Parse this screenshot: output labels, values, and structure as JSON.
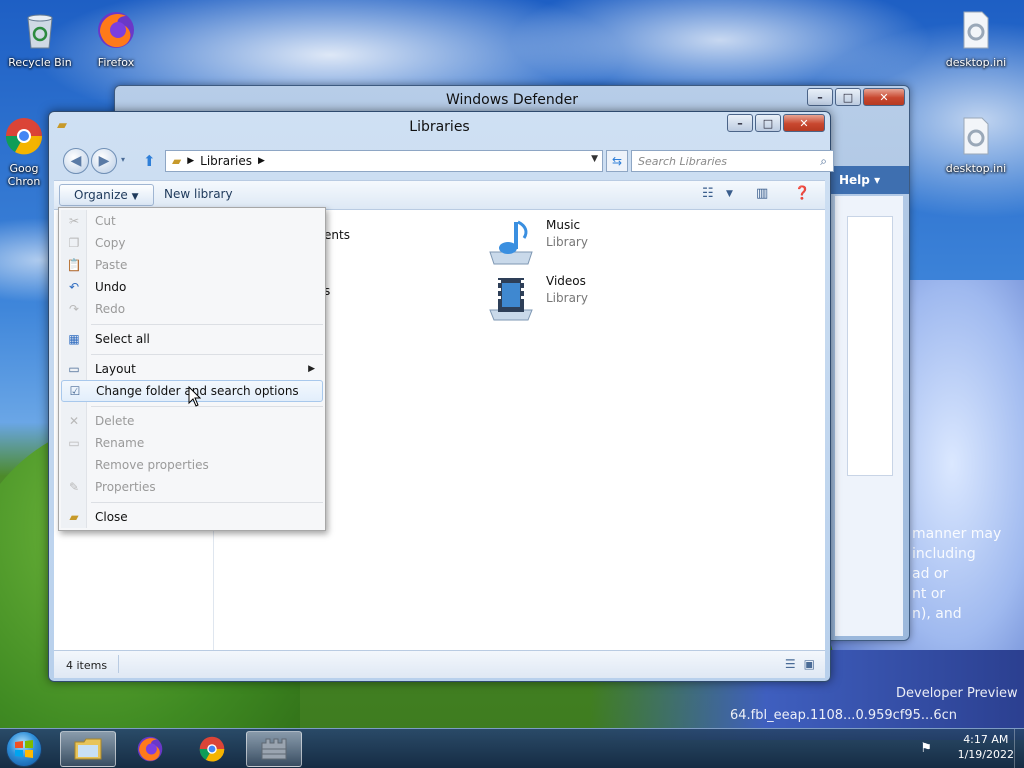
{
  "desktop": {
    "icons": [
      {
        "label": "Recycle Bin",
        "icon": "recycle-bin-icon"
      },
      {
        "label": "Firefox",
        "icon": "firefox-icon"
      },
      {
        "label": "Goog Chron",
        "icon": "chrome-icon"
      },
      {
        "label": "desktop.ini",
        "icon": "settings-file-icon"
      },
      {
        "label": "desktop.ini",
        "icon": "settings-file-icon"
      }
    ],
    "watermark_lines": [
      "manner may",
      "including",
      "ad or",
      "nt or",
      "n), and",
      "Developer Preview",
      "64.fbl_eeap.1108...0.959cf95...6cn"
    ]
  },
  "defender_window": {
    "title": "Windows Defender",
    "help_label": "Help"
  },
  "explorer": {
    "title": "Libraries",
    "address": {
      "crumb": "Libraries"
    },
    "search": {
      "placeholder": "Search Libraries"
    },
    "command_bar": {
      "organize_label": "Organize",
      "new_library_label": "New library"
    },
    "libraries": [
      {
        "name": "Music",
        "type": "Library",
        "icon": "music-library-icon"
      },
      {
        "name": "Videos",
        "type": "Library",
        "icon": "videos-library-icon"
      }
    ],
    "partial_text": {
      "documents": "ents",
      "pictures": "s"
    },
    "status": {
      "item_count": "4 items"
    }
  },
  "organize_menu": {
    "items": [
      {
        "label": "Cut",
        "enabled": false,
        "icon": "cut-icon"
      },
      {
        "label": "Copy",
        "enabled": false,
        "icon": "copy-icon"
      },
      {
        "label": "Paste",
        "enabled": false,
        "icon": "paste-icon"
      },
      {
        "label": "Undo",
        "enabled": true,
        "icon": "undo-icon"
      },
      {
        "label": "Redo",
        "enabled": false,
        "icon": "redo-icon"
      },
      {
        "label": "Select all",
        "enabled": true,
        "icon": "select-all-icon"
      },
      {
        "label": "Layout",
        "enabled": true,
        "icon": "layout-icon",
        "submenu": true
      },
      {
        "label": "Change folder and search options",
        "enabled": true,
        "icon": "folder-options-icon",
        "highlighted": true
      },
      {
        "label": "Delete",
        "enabled": false,
        "icon": "delete-icon"
      },
      {
        "label": "Rename",
        "enabled": false,
        "icon": "rename-icon"
      },
      {
        "label": "Remove properties",
        "enabled": false,
        "icon": "remove-properties-icon"
      },
      {
        "label": "Properties",
        "enabled": false,
        "icon": "properties-icon"
      },
      {
        "label": "Close",
        "enabled": true,
        "icon": "close-folder-icon"
      }
    ]
  },
  "taskbar": {
    "clock_time": "4:17 AM",
    "clock_date": "1/19/2022"
  },
  "colors": {
    "menu_highlight_border": "#a8c8ec",
    "disabled_text": "#9a9a9a",
    "close_button": "#c8472f"
  }
}
